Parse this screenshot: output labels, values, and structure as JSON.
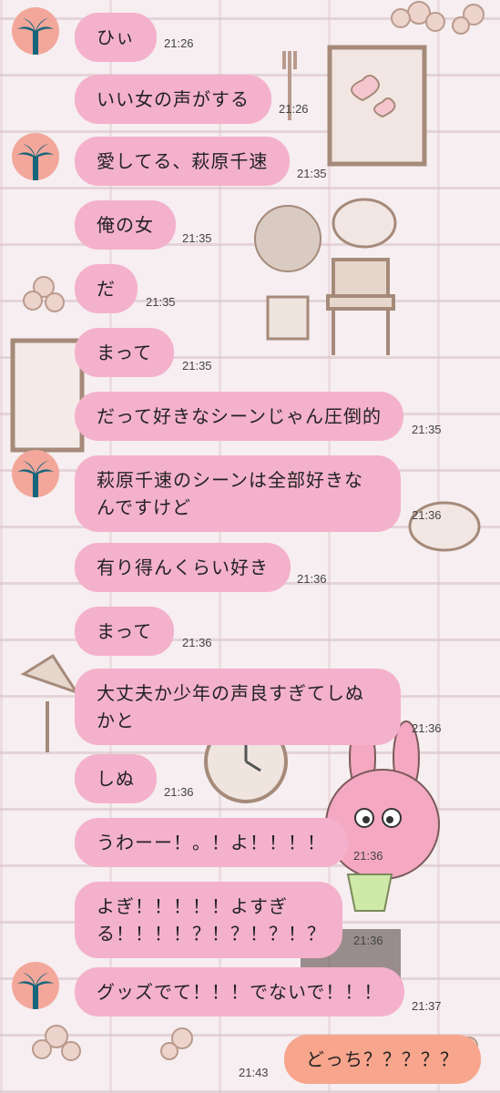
{
  "colors": {
    "incoming_bubble": "#f4b1cb",
    "outgoing_bubble": "#f7a58c",
    "avatar_bg": "#f2a79a",
    "background": "#f6eef0"
  },
  "icons": {
    "avatar": "palm-tree-icon"
  },
  "messages": [
    {
      "text": "ひぃ",
      "time": "21:26"
    },
    {
      "text": "いい女の声がする",
      "time": "21:26"
    },
    {
      "text": "愛してる、萩原千速",
      "time": "21:35"
    },
    {
      "text": "俺の女",
      "time": "21:35"
    },
    {
      "text": "だ",
      "time": "21:35"
    },
    {
      "text": "まって",
      "time": "21:35"
    },
    {
      "text": "だって好きなシーンじゃん圧倒的",
      "time": "21:35"
    },
    {
      "text": "萩原千速のシーンは全部好きなんですけど",
      "time": "21:36"
    },
    {
      "text": "有り得んくらい好き",
      "time": "21:36"
    },
    {
      "text": "まって",
      "time": "21:36"
    },
    {
      "text": "大丈夫か少年の声良すぎてしぬかと",
      "time": "21:36"
    },
    {
      "text": "しぬ",
      "time": "21:36"
    },
    {
      "text": "うわーー！。！よ！！！！",
      "time": "21:36"
    },
    {
      "text": "よぎ！！！！！よすぎる！！！！？！？！？！？",
      "time": "21:36"
    },
    {
      "text": "グッズでて！！！でないで！！！",
      "time": "21:37"
    },
    {
      "text": "どっち？？？？？",
      "time": "21:43"
    }
  ]
}
